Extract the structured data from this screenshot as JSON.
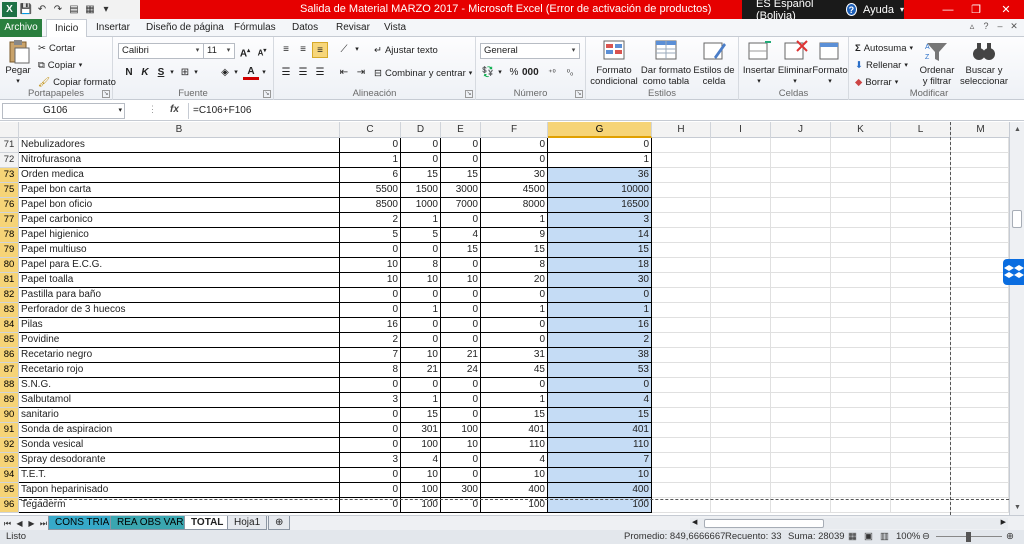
{
  "window": {
    "title": "Salida de Material MARZO 2017  -  Microsoft Excel (Error de activación de productos)",
    "language": "ES Español (Bolivia)",
    "help": "Ayuda"
  },
  "ribbon_tabs": [
    "Archivo",
    "Inicio",
    "Insertar",
    "Diseño de página",
    "Fórmulas",
    "Datos",
    "Revisar",
    "Vista"
  ],
  "ribbon": {
    "clipboard": {
      "paste": "Pegar",
      "cut": "Cortar",
      "copy": "Copiar",
      "format_painter": "Copiar formato",
      "label": "Portapapeles"
    },
    "font": {
      "name": "Calibri",
      "size": "11",
      "label": "Fuente"
    },
    "alignment": {
      "wrap": "Ajustar texto",
      "merge": "Combinar y centrar",
      "label": "Alineación"
    },
    "number": {
      "format": "General",
      "label": "Número"
    },
    "styles": {
      "conditional": [
        "Formato",
        "condicional"
      ],
      "table": [
        "Dar formato",
        "como tabla"
      ],
      "cell": [
        "Estilos de",
        "celda"
      ],
      "label": "Estilos"
    },
    "cells": {
      "insert": "Insertar",
      "delete": "Eliminar",
      "format": "Formato",
      "label": "Celdas"
    },
    "editing": {
      "autosum": "Autosuma",
      "fill": "Rellenar",
      "clear": "Borrar",
      "sort": [
        "Ordenar",
        "y filtrar"
      ],
      "find": [
        "Buscar y",
        "seleccionar"
      ],
      "label": "Modificar"
    }
  },
  "formula_bar": {
    "name_box": "G106",
    "fx": "fx",
    "formula": "=C106+F106"
  },
  "columns": [
    "B",
    "C",
    "D",
    "E",
    "F",
    "G",
    "H",
    "I",
    "J",
    "K",
    "L",
    "M"
  ],
  "rows": [
    {
      "n": "71",
      "name": "Nebulizadores",
      "c": "0",
      "d": "0",
      "e": "0",
      "f": "0",
      "g": "0"
    },
    {
      "n": "72",
      "name": "Nitrofurasona",
      "c": "1",
      "d": "0",
      "e": "0",
      "f": "0",
      "g": "1"
    },
    {
      "n": "73",
      "name": "Orden medica",
      "c": "6",
      "d": "15",
      "e": "15",
      "f": "30",
      "g": "36"
    },
    {
      "n": "75",
      "name": "Papel bon carta",
      "c": "5500",
      "d": "1500",
      "e": "3000",
      "f": "4500",
      "g": "10000"
    },
    {
      "n": "76",
      "name": "Papel bon oficio",
      "c": "8500",
      "d": "1000",
      "e": "7000",
      "f": "8000",
      "g": "16500"
    },
    {
      "n": "77",
      "name": "Papel carbonico",
      "c": "2",
      "d": "1",
      "e": "0",
      "f": "1",
      "g": "3"
    },
    {
      "n": "78",
      "name": "Papel higienico",
      "c": "5",
      "d": "5",
      "e": "4",
      "f": "9",
      "g": "14"
    },
    {
      "n": "79",
      "name": "Papel multiuso",
      "c": "0",
      "d": "0",
      "e": "15",
      "f": "15",
      "g": "15"
    },
    {
      "n": "80",
      "name": "Papel para E.C.G.",
      "c": "10",
      "d": "8",
      "e": "0",
      "f": "8",
      "g": "18"
    },
    {
      "n": "81",
      "name": "Papel toalla",
      "c": "10",
      "d": "10",
      "e": "10",
      "f": "20",
      "g": "30"
    },
    {
      "n": "82",
      "name": "Pastilla para baño",
      "c": "0",
      "d": "0",
      "e": "0",
      "f": "0",
      "g": "0"
    },
    {
      "n": "83",
      "name": "Perforador de 3 huecos",
      "c": "0",
      "d": "1",
      "e": "0",
      "f": "1",
      "g": "1"
    },
    {
      "n": "84",
      "name": "Pilas",
      "c": "16",
      "d": "0",
      "e": "0",
      "f": "0",
      "g": "16"
    },
    {
      "n": "85",
      "name": "Povidine",
      "c": "2",
      "d": "0",
      "e": "0",
      "f": "0",
      "g": "2"
    },
    {
      "n": "86",
      "name": "Recetario negro",
      "c": "7",
      "d": "10",
      "e": "21",
      "f": "31",
      "g": "38"
    },
    {
      "n": "87",
      "name": "Recetario rojo",
      "c": "8",
      "d": "21",
      "e": "24",
      "f": "45",
      "g": "53"
    },
    {
      "n": "88",
      "name": "S.N.G.",
      "c": "0",
      "d": "0",
      "e": "0",
      "f": "0",
      "g": "0"
    },
    {
      "n": "89",
      "name": "Salbutamol",
      "c": "3",
      "d": "1",
      "e": "0",
      "f": "1",
      "g": "4"
    },
    {
      "n": "90",
      "name": "sanitario",
      "c": "0",
      "d": "15",
      "e": "0",
      "f": "15",
      "g": "15"
    },
    {
      "n": "91",
      "name": "Sonda de aspiracion",
      "c": "0",
      "d": "301",
      "e": "100",
      "f": "401",
      "g": "401"
    },
    {
      "n": "92",
      "name": "Sonda vesical",
      "c": "0",
      "d": "100",
      "e": "10",
      "f": "110",
      "g": "110"
    },
    {
      "n": "93",
      "name": "Spray desodorante",
      "c": "3",
      "d": "4",
      "e": "0",
      "f": "4",
      "g": "7"
    },
    {
      "n": "94",
      "name": "T.E.T.",
      "c": "0",
      "d": "10",
      "e": "0",
      "f": "10",
      "g": "10"
    },
    {
      "n": "95",
      "name": "Tapon heparinisado",
      "c": "0",
      "d": "100",
      "e": "300",
      "f": "400",
      "g": "400"
    },
    {
      "n": "96",
      "name": "Tegaderm",
      "c": "0",
      "d": "100",
      "e": "0",
      "f": "100",
      "g": "100"
    }
  ],
  "sheets": [
    "CONS TRIA",
    "REA OBS VAR",
    "TOTAL",
    "Hoja1"
  ],
  "status": {
    "ready": "Listo",
    "average": "Promedio: 849,6666667",
    "count": "Recuento: 33",
    "sum": "Suma: 28039",
    "zoom": "100%"
  },
  "colors": {
    "title_bar": "#e60000",
    "file_tab": "#2a7f3e",
    "selection": "#c5dcf5",
    "header_selected": "#f6d477"
  }
}
